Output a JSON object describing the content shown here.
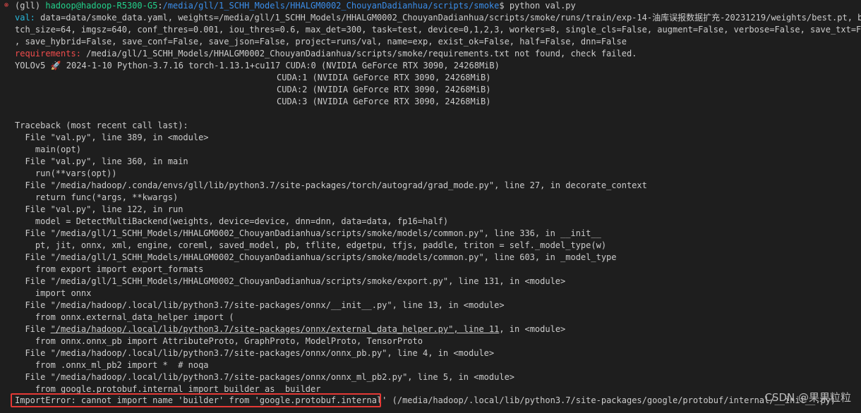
{
  "prompt": {
    "env": "(gll) ",
    "userhost": "hadoop@hadoop-R5300-G5",
    "sep": ":",
    "path": "/media/gll/1_SCHH_Models/HHALGM0002_ChouyanDadianhua/scripts/smoke",
    "cmd": "$ python val.py"
  },
  "val_line": {
    "label": "val: ",
    "text1": "data=data/smoke_data.yaml, weights=/media/gll/1_SCHH_Models/HHALGM0002_ChouyanDadianhua/scripts/smoke/runs/train/exp-14-油库误报数据扩充-20231219/weights/best.pt, ba",
    "text2": "tch_size=64, imgsz=640, conf_thres=0.001, iou_thres=0.6, max_det=300, task=test, device=0,1,2,3, workers=8, single_cls=False, augment=False, verbose=False, save_txt=False",
    "text3": ", save_hybrid=False, save_conf=False, save_json=False, project=runs/val, name=exp, exist_ok=False, half=False, dnn=False"
  },
  "requirements": {
    "label": "requirements:",
    "text": " /media/gll/1_SCHH_Models/HHALGM0002_ChouyanDadianhua/scripts/smoke/requirements.txt not found, check failed."
  },
  "yolo": {
    "prefix": "YOLOv5 ",
    "rocket": "🚀",
    "text": " 2024-1-10 Python-3.7.16 torch-1.13.1+cu117 CUDA:0 (NVIDIA GeForce RTX 3090, 24268MiB)",
    "cuda1": "CUDA:1 (NVIDIA GeForce RTX 3090, 24268MiB)",
    "cuda2": "CUDA:2 (NVIDIA GeForce RTX 3090, 24268MiB)",
    "cuda3": "CUDA:3 (NVIDIA GeForce RTX 3090, 24268MiB)"
  },
  "traceback": [
    "Traceback (most recent call last):",
    "  File \"val.py\", line 389, in <module>",
    "    main(opt)",
    "  File \"val.py\", line 360, in main",
    "    run(**vars(opt))",
    "  File \"/media/hadoop/.conda/envs/gll/lib/python3.7/site-packages/torch/autograd/grad_mode.py\", line 27, in decorate_context",
    "    return func(*args, **kwargs)",
    "  File \"val.py\", line 122, in run",
    "    model = DetectMultiBackend(weights, device=device, dnn=dnn, data=data, fp16=half)",
    "  File \"/media/gll/1_SCHH_Models/HHALGM0002_ChouyanDadianhua/scripts/smoke/models/common.py\", line 336, in __init__",
    "    pt, jit, onnx, xml, engine, coreml, saved_model, pb, tflite, edgetpu, tfjs, paddle, triton = self._model_type(w)",
    "  File \"/media/gll/1_SCHH_Models/HHALGM0002_ChouyanDadianhua/scripts/smoke/models/common.py\", line 603, in _model_type",
    "    from export import export_formats",
    "  File \"/media/gll/1_SCHH_Models/HHALGM0002_ChouyanDadianhua/scripts/smoke/export.py\", line 131, in <module>",
    "    import onnx",
    "  File \"/media/hadoop/.local/lib/python3.7/site-packages/onnx/__init__.py\", line 13, in <module>",
    "    from onnx.external_data_helper import (",
    "  File \"/media/hadoop/.local/lib/python3.7/site-packages/onnx/external_data_helper.py\", line 11, in <module>",
    "    from onnx.onnx_pb import AttributeProto, GraphProto, ModelProto, TensorProto",
    "  File \"/media/hadoop/.local/lib/python3.7/site-packages/onnx/onnx_pb.py\", line 4, in <module>",
    "    from .onnx_ml_pb2 import *  # noqa",
    "  File \"/media/hadoop/.local/lib/python3.7/site-packages/onnx/onnx_ml_pb2.py\", line 5, in <module>",
    "    from google.protobuf.internal import builder as _builder"
  ],
  "error": {
    "text": "ImportError: cannot import name 'builder' from 'google.protobuf.internal'",
    "rest": " (/media/hadoop/.local/lib/python3.7/site-packages/google/protobuf/internal/__init__.py)"
  },
  "watermark": "CSDN @果果粒粒",
  "icons": {
    "status": "error-circle-icon"
  }
}
